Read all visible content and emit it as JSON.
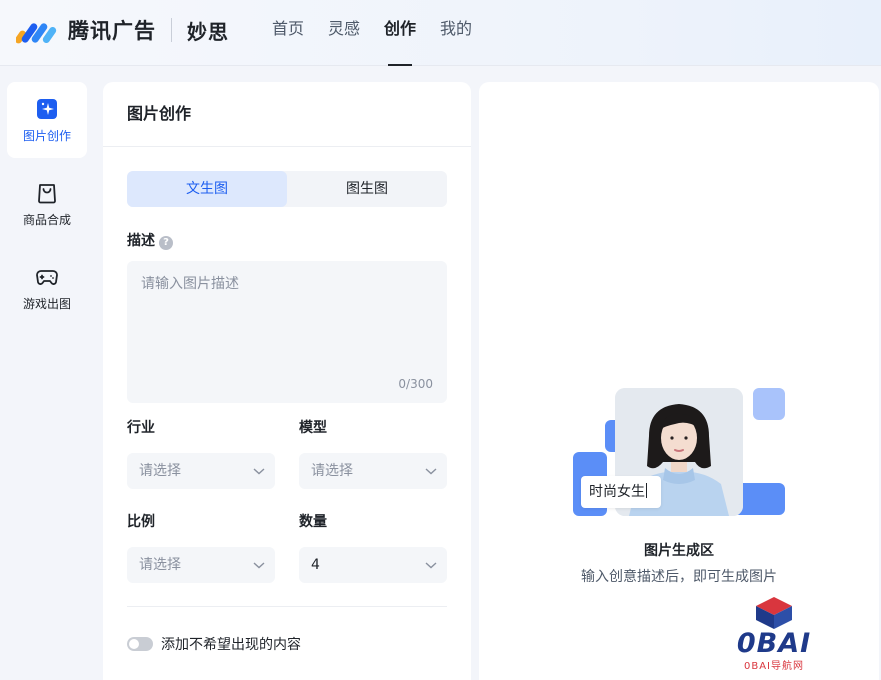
{
  "header": {
    "brand": "腾讯广告",
    "product": "妙思",
    "nav": [
      {
        "label": "首页",
        "active": false
      },
      {
        "label": "灵感",
        "active": false
      },
      {
        "label": "创作",
        "active": true
      },
      {
        "label": "我的",
        "active": false
      }
    ]
  },
  "sidebar": {
    "items": [
      {
        "label": "图片创作",
        "icon": "sparkle-icon",
        "active": true
      },
      {
        "label": "商品合成",
        "icon": "shopping-bag-icon",
        "active": false
      },
      {
        "label": "游戏出图",
        "icon": "gamepad-icon",
        "active": false
      }
    ]
  },
  "form": {
    "title": "图片创作",
    "tabs": [
      {
        "label": "文生图",
        "active": true
      },
      {
        "label": "图生图",
        "active": false
      }
    ],
    "description": {
      "label": "描述",
      "help_icon": "?",
      "placeholder": "请输入图片描述",
      "counter": "0/300"
    },
    "industry": {
      "label": "行业",
      "value": "请选择"
    },
    "model": {
      "label": "模型",
      "value": "请选择"
    },
    "ratio": {
      "label": "比例",
      "value": "请选择"
    },
    "quantity": {
      "label": "数量",
      "value": "4"
    },
    "negative_toggle": {
      "label": "添加不希望出现的内容",
      "on": false
    }
  },
  "result": {
    "illustration_text": "时尚女生",
    "title": "图片生成区",
    "subtitle": "输入创意描述后，即可生成图片"
  },
  "watermark": {
    "text": "0BAI",
    "sub": "0BAI导航网"
  },
  "colors": {
    "accent": "#1d5ef0",
    "accent_light": "#dde8fd",
    "illus_blue": "#5b8ef7",
    "illus_light": "#a9c3fb"
  }
}
